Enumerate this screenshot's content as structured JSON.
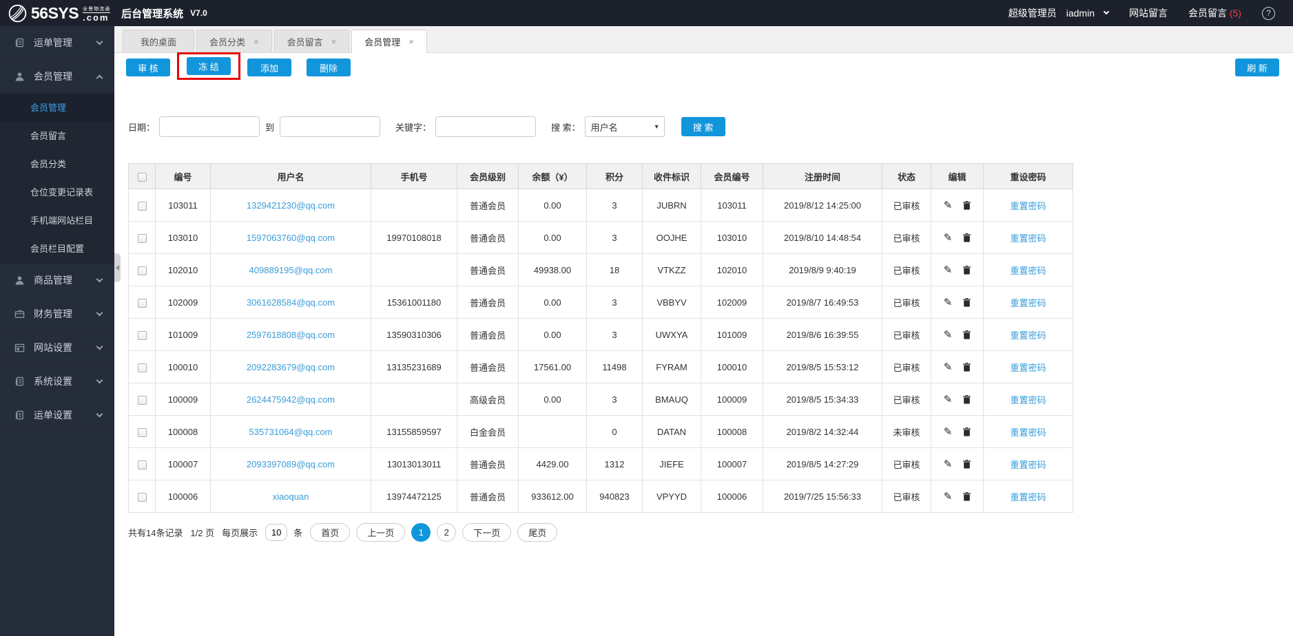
{
  "colors": {
    "accent": "#1296db",
    "highlight_red": "#e60000",
    "link_blue": "#3a9cd9",
    "badge_red": "#e8414d"
  },
  "header": {
    "logo_main": "56SYS",
    "logo_sub": "全景物流通",
    "logo_com": ".com",
    "title": "后台管理系统",
    "version": "V7.0",
    "role": "超级管理员",
    "username": "iadmin",
    "nav_site_msg": "网站留言",
    "nav_member_msg": "会员留言",
    "member_msg_count": "(5)",
    "help": "?"
  },
  "sidebar": {
    "groups": [
      {
        "label": "运单管理",
        "icon": "document-icon",
        "expanded": false
      },
      {
        "label": "会员管理",
        "icon": "user-icon",
        "expanded": true,
        "children": [
          {
            "label": "会员管理",
            "active": true
          },
          {
            "label": "会员留言",
            "active": false
          },
          {
            "label": "会员分类",
            "active": false
          },
          {
            "label": "仓位变更记录表",
            "active": false
          },
          {
            "label": "手机端网站栏目",
            "active": false
          },
          {
            "label": "会员栏目配置",
            "active": false
          }
        ]
      },
      {
        "label": "商品管理",
        "icon": "user-icon",
        "expanded": false
      },
      {
        "label": "财务管理",
        "icon": "wallet-icon",
        "expanded": false
      },
      {
        "label": "网站设置",
        "icon": "browser-icon",
        "expanded": false
      },
      {
        "label": "系统设置",
        "icon": "document-icon",
        "expanded": false
      },
      {
        "label": "运单设置",
        "icon": "document-icon",
        "expanded": false
      }
    ]
  },
  "tabs": [
    {
      "label": "我的桌面",
      "closable": false,
      "active": false
    },
    {
      "label": "会员分类",
      "closable": true,
      "active": false
    },
    {
      "label": "会员留言",
      "closable": true,
      "active": false
    },
    {
      "label": "会员管理",
      "closable": true,
      "active": true
    }
  ],
  "toolbar": {
    "audit": "审 核",
    "freeze": "冻 结",
    "add": "添加",
    "delete": "删除",
    "refresh": "刷 新"
  },
  "search": {
    "date_label": "日期：",
    "to_label": "到",
    "keyword_label": "关键字：",
    "search_label": "搜 索：",
    "select_value": "用户名",
    "button": "搜 索"
  },
  "table": {
    "columns": [
      "编号",
      "用户名",
      "手机号",
      "会员级别",
      "余额（¥）",
      "积分",
      "收件标识",
      "会员编号",
      "注册时间",
      "状态",
      "编辑",
      "重设密码"
    ],
    "reset_label": "重置密码",
    "rows": [
      {
        "id": "103011",
        "username": "1329421230@qq.com",
        "phone": "",
        "level": "普通会员",
        "balance": "0.00",
        "points": "3",
        "code": "JUBRN",
        "member_id": "103011",
        "reg_time": "2019/8/12 14:25:00",
        "status": "已审核"
      },
      {
        "id": "103010",
        "username": "1597063760@qq.com",
        "phone": "19970108018",
        "level": "普通会员",
        "balance": "0.00",
        "points": "3",
        "code": "OOJHE",
        "member_id": "103010",
        "reg_time": "2019/8/10 14:48:54",
        "status": "已审核"
      },
      {
        "id": "102010",
        "username": "409889195@qq.com",
        "phone": "",
        "level": "普通会员",
        "balance": "49938.00",
        "points": "18",
        "code": "VTKZZ",
        "member_id": "102010",
        "reg_time": "2019/8/9 9:40:19",
        "status": "已审核"
      },
      {
        "id": "102009",
        "username": "3061628584@qq.com",
        "phone": "15361001180",
        "level": "普通会员",
        "balance": "0.00",
        "points": "3",
        "code": "VBBYV",
        "member_id": "102009",
        "reg_time": "2019/8/7 16:49:53",
        "status": "已审核"
      },
      {
        "id": "101009",
        "username": "2597618808@qq.com",
        "phone": "13590310306",
        "level": "普通会员",
        "balance": "0.00",
        "points": "3",
        "code": "UWXYA",
        "member_id": "101009",
        "reg_time": "2019/8/6 16:39:55",
        "status": "已审核"
      },
      {
        "id": "100010",
        "username": "2092283679@qq.com",
        "phone": "13135231689",
        "level": "普通会员",
        "balance": "17561.00",
        "points": "11498",
        "code": "FYRAM",
        "member_id": "100010",
        "reg_time": "2019/8/5 15:53:12",
        "status": "已审核"
      },
      {
        "id": "100009",
        "username": "2624475942@qq.com",
        "phone": "",
        "level": "高级会员",
        "balance": "0.00",
        "points": "3",
        "code": "BMAUQ",
        "member_id": "100009",
        "reg_time": "2019/8/5 15:34:33",
        "status": "已审核"
      },
      {
        "id": "100008",
        "username": "535731064@qq.com",
        "phone": "13155859597",
        "level": "白金会员",
        "balance": "",
        "points": "0",
        "code": "DATAN",
        "member_id": "100008",
        "reg_time": "2019/8/2 14:32:44",
        "status": "未审核"
      },
      {
        "id": "100007",
        "username": "2093397089@qq.com",
        "phone": "13013013011",
        "level": "普通会员",
        "balance": "4429.00",
        "points": "1312",
        "code": "JIEFE",
        "member_id": "100007",
        "reg_time": "2019/8/5 14:27:29",
        "status": "已审核"
      },
      {
        "id": "100006",
        "username": "xiaoquan",
        "phone": "13974472125",
        "level": "普通会员",
        "balance": "933612.00",
        "points": "940823",
        "code": "VPYYD",
        "member_id": "100006",
        "reg_time": "2019/7/25 15:56:33",
        "status": "已审核"
      }
    ]
  },
  "pagination": {
    "total": "共有14条记录",
    "page_info": "1/2 页",
    "per_page_label": "每页展示",
    "per_page_value": "10",
    "per_page_unit": "条",
    "first": "首页",
    "prev": "上一页",
    "pages": [
      "1",
      "2"
    ],
    "active_page": "1",
    "next": "下一页",
    "last": "尾页"
  }
}
